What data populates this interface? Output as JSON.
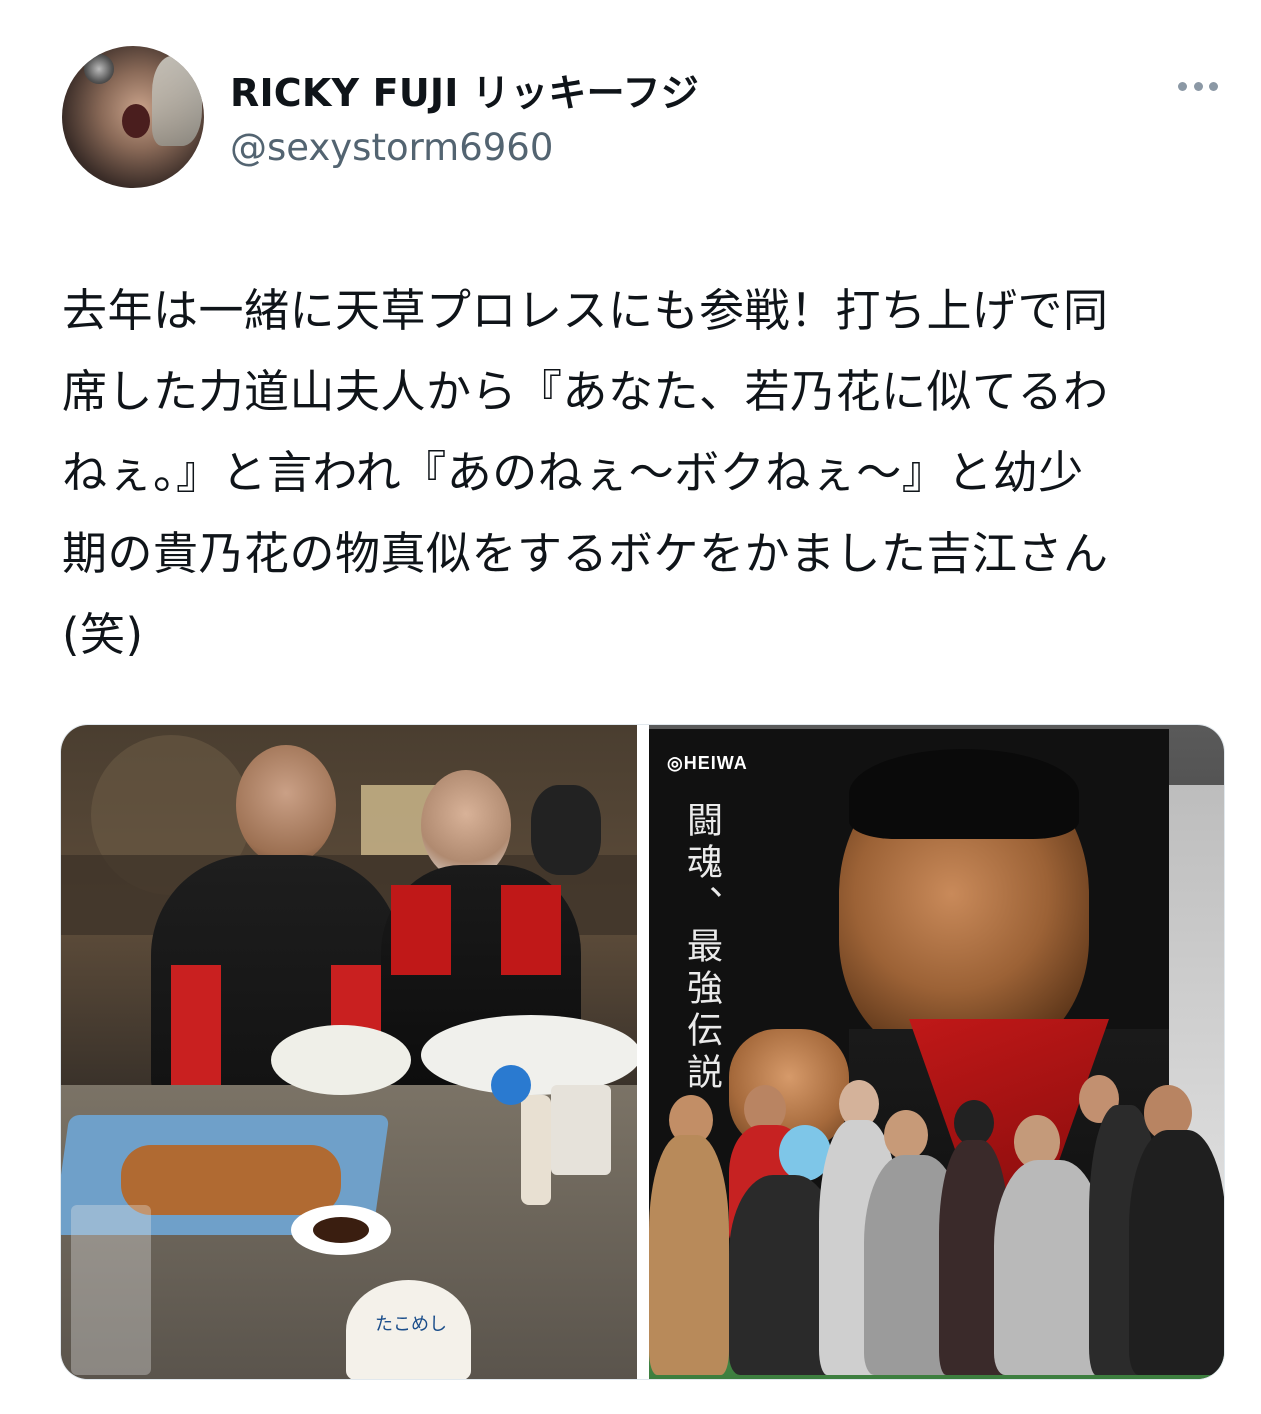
{
  "tweet": {
    "author": {
      "name": "RICKY FUJI リッキーフジ",
      "handle": "@sexystorm6960"
    },
    "text_lines": [
      "去年は一緒に天草プロレスにも参戦！打ち上げで同",
      "席した力道山夫人から『あなた、若乃花に似てるわ",
      "ねぇ。』と言われ『あのねぇ〜ボクねぇ〜』と幼少",
      "期の貴乃花の物真似をするボケをかました吉江さん",
      "(笑)"
    ],
    "media": {
      "left_photo": {
        "label": "restaurant-group-photo",
        "sign_text": "たこめし"
      },
      "right_photo": {
        "label": "wrestlers-in-front-of-banner",
        "brand_text": "HEIWA",
        "banner_text": "闘魂、最強伝説"
      }
    },
    "icons": {
      "more": "more-horizontal-icon"
    }
  }
}
